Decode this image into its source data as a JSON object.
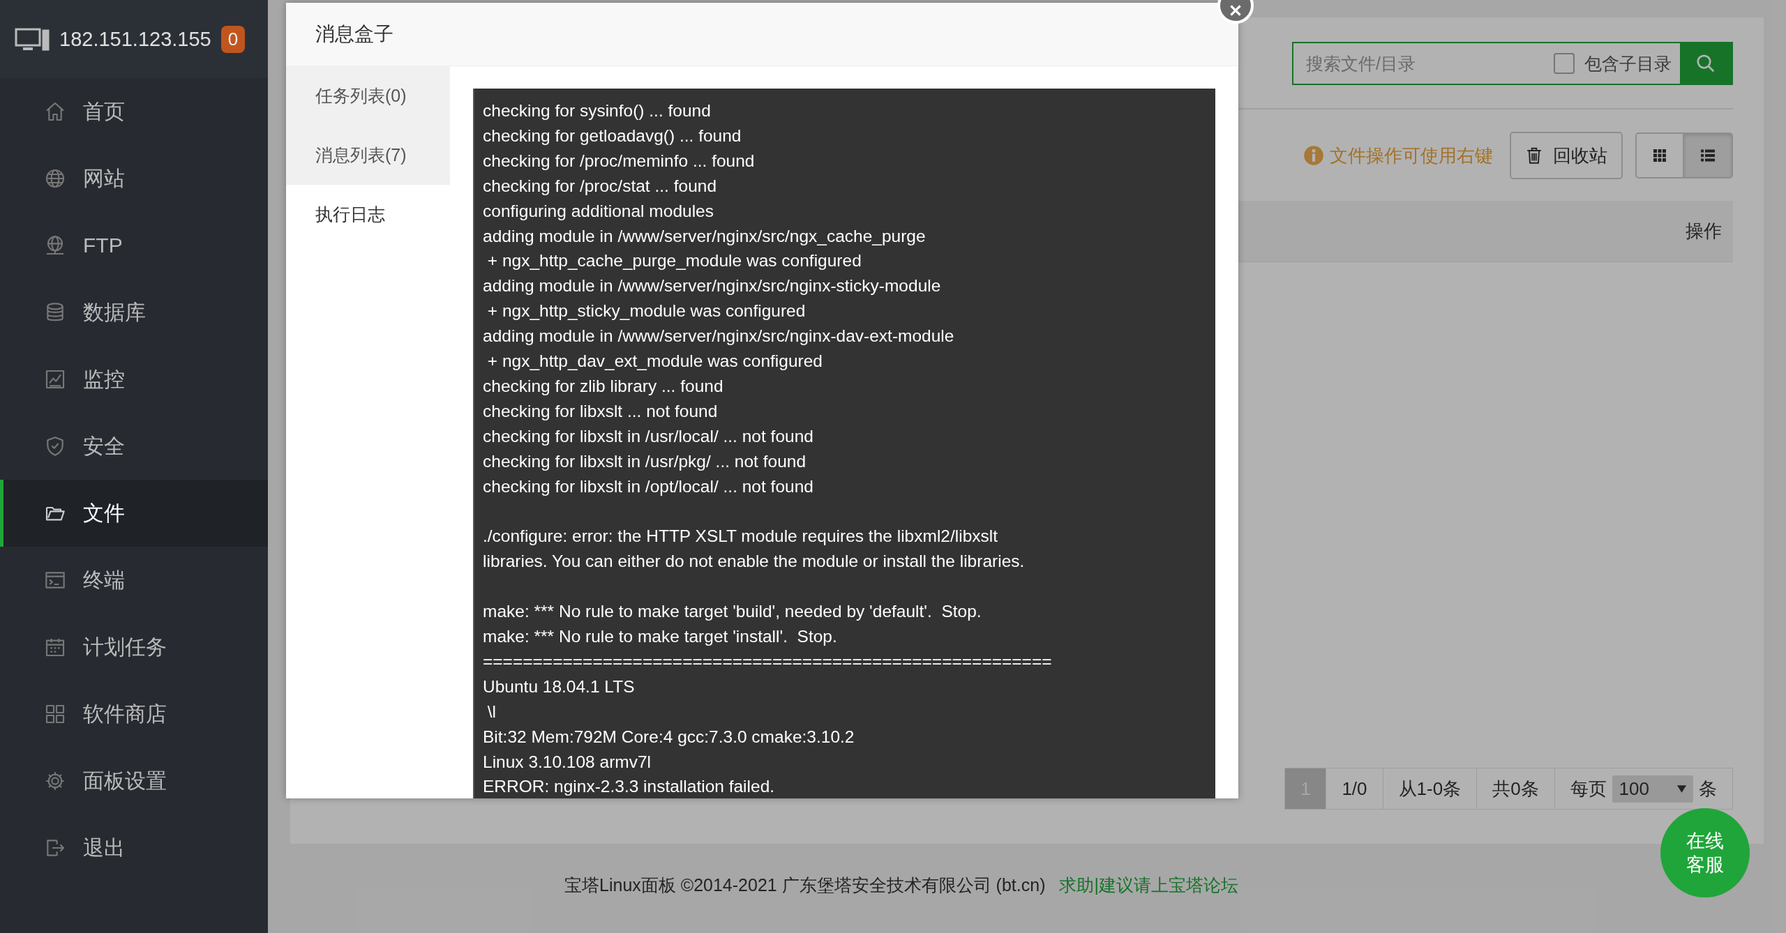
{
  "sidebar": {
    "host": "182.151.123.155",
    "badge": "0",
    "items": [
      {
        "label": "首页",
        "selected": false
      },
      {
        "label": "网站",
        "selected": false
      },
      {
        "label": "FTP",
        "selected": false
      },
      {
        "label": "数据库",
        "selected": false
      },
      {
        "label": "监控",
        "selected": false
      },
      {
        "label": "安全",
        "selected": false
      },
      {
        "label": "文件",
        "selected": true
      },
      {
        "label": "终端",
        "selected": false
      },
      {
        "label": "计划任务",
        "selected": false
      },
      {
        "label": "软件商店",
        "selected": false
      },
      {
        "label": "面板设置",
        "selected": false
      },
      {
        "label": "退出",
        "selected": false
      }
    ]
  },
  "toolbar": {
    "search_placeholder": "搜索文件/目录",
    "include_subdirs": {
      "label": "包含子目录",
      "checked": false
    },
    "hint": "文件操作可使用右键",
    "recycle_bin": "回收站",
    "views": [
      {
        "kind": "grid",
        "selected": false
      },
      {
        "kind": "list",
        "selected": true
      }
    ]
  },
  "table": {
    "columns": [
      "操作"
    ]
  },
  "pagination": {
    "pages": [
      {
        "label": "1",
        "selected": true
      }
    ],
    "page_count": "1/0",
    "range": "从1-0条",
    "total": "共0条",
    "per_page_label": "每页",
    "per_page": "100",
    "per_page_unit": "条"
  },
  "footer": {
    "copyright": "宝塔Linux面板 ©2014-2021 广东堡塔安全技术有限公司 (bt.cn)",
    "link": "求助|建议请上宝塔论坛"
  },
  "chat_button": "在线客服",
  "dialog": {
    "title": "消息盒子",
    "tabs": [
      {
        "label": "任务列表(0)",
        "selected": false
      },
      {
        "label": "消息列表(7)",
        "selected": false
      },
      {
        "label": "执行日志",
        "selected": true
      }
    ],
    "log": [
      [
        "checking for sysinfo() ... found",
        "checking for getloadavg() ... found",
        "checking for /proc/meminfo ... found",
        "checking for /proc/stat ... found",
        "configuring additional modules",
        "adding module in /www/server/nginx/src/ngx_cache_purge",
        " + ngx_http_cache_purge_module was configured",
        "adding module in /www/server/nginx/src/nginx-sticky-module",
        " + ngx_http_sticky_module was configured",
        "adding module in /www/server/nginx/src/nginx-dav-ext-module",
        " + ngx_http_dav_ext_module was configured",
        "checking for zlib library ... found",
        "checking for libxslt ... not found",
        "checking for libxslt in /usr/local/ ... not found",
        "checking for libxslt in /usr/pkg/ ... not found",
        "checking for libxslt in /opt/local/ ... not found"
      ],
      [
        "./configure: error: the HTTP XSLT module requires the libxml2/libxslt",
        "libraries. You can either do not enable the module or install the libraries."
      ],
      [
        "make: *** No rule to make target 'build', needed by 'default'.  Stop.",
        "make: *** No rule to make target 'install'.  Stop.",
        "=========================================================",
        "Ubuntu 18.04.1 LTS",
        " \\l",
        "Bit:32 Mem:792M Core:4 gcc:7.3.0 cmake:3.10.2",
        "Linux 3.10.108 armv7l",
        "ERROR: nginx-2.3.3 installation failed."
      ]
    ]
  }
}
